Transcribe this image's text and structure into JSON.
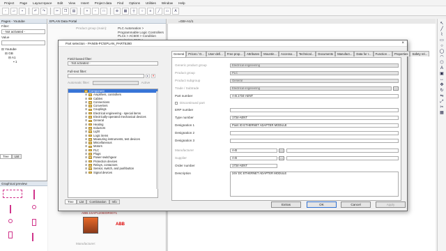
{
  "menu": [
    "Project",
    "Page",
    "Layout space",
    "Edit",
    "View",
    "Insert",
    "Project data",
    "Find",
    "Options",
    "Utilities",
    "Window",
    "Help"
  ],
  "left_pane": {
    "title": "Pages - Youtube",
    "filter_label": "Filter:",
    "filter_value": "- Not activated -",
    "value_label": "Value",
    "tree": [
      "Youtube",
      "GB",
      "A1",
      "1"
    ],
    "tabs": [
      "Tree",
      "List"
    ]
  },
  "graphical_preview": {
    "title": "Graphical preview"
  },
  "portal": {
    "title": "EPLAN Data Portal",
    "product_group_label": "Product group (main):",
    "product_group_value": "PLC Automation > Programmable Logic Controllers PLCs > AC500 > Condition Monitoring CMS >",
    "product_code": "ABB.1SAP120600R0071",
    "manufacturer_label": "Manufacturer:",
    "manufacturer_logo": "ABB"
  },
  "canvas_tab": "=GB+A1/1",
  "dialog": {
    "title": "Part selection - PAN05-PC\\EPLAN_PART5280",
    "field_filter_label": "Field-based filter:",
    "field_filter_value": "- Not activated -",
    "fulltext_label": "Full-text filter:",
    "auto_filter_label": "Automatic filter:",
    "active_label": "Active",
    "tree": [
      {
        "label": "Component",
        "sel": true
      },
      {
        "label": "Amplifiers, controllers"
      },
      {
        "label": "Cables"
      },
      {
        "label": "Connections"
      },
      {
        "label": "Converters"
      },
      {
        "label": "Couplings"
      },
      {
        "label": "Electrical engineering - special items"
      },
      {
        "label": "Electrically-operated mechanical devices"
      },
      {
        "label": "General"
      },
      {
        "label": "Heating"
      },
      {
        "label": "Inductors"
      },
      {
        "label": "Light"
      },
      {
        "label": "Logic items"
      },
      {
        "label": "Measuring instruments, test devices"
      },
      {
        "label": "Miscellaneous"
      },
      {
        "label": "Motors"
      },
      {
        "label": "PLC"
      },
      {
        "label": "Plugs"
      },
      {
        "label": "Power switchgear"
      },
      {
        "label": "Protection devices"
      },
      {
        "label": "Relays, contactors"
      },
      {
        "label": "Sensor, switch, and pushbutton"
      },
      {
        "label": "Signal devices"
      }
    ],
    "bottom_tabs": [
      "Tree",
      "List",
      "Combination",
      "Info"
    ],
    "prop_tabs": [
      "General",
      "Prices / O...",
      "User-defi...",
      "Free prop...",
      "Attributes",
      "Mountin...",
      "Accesso...",
      "Technical...",
      "Documents",
      "Manufact...",
      "Data for r...",
      "Function ...",
      "Properties",
      "Safety rel..."
    ],
    "fields": {
      "generic_product_group": {
        "label": "Generic product group",
        "value": "Electrical engineering"
      },
      "product_group": {
        "label": "Product group",
        "value": "PLC"
      },
      "product_subgroup": {
        "label": "Product subgroup",
        "value": "General"
      },
      "trade": {
        "label": "Trade / Subtrade",
        "value": "Electrical engineering"
      },
      "part_number": {
        "label": "Part number",
        "value": "A-B.1734-AENT"
      },
      "discontinued": {
        "label": "Discontinued part"
      },
      "erp_number": {
        "label": "ERP number",
        "value": ""
      },
      "type_number": {
        "label": "Type number",
        "value": "1734-AENT"
      },
      "designation1": {
        "label": "Designation 1",
        "value": "Point IO ETHERNET ADAPTER MODULE"
      },
      "designation2": {
        "label": "Designation 2",
        "value": ""
      },
      "designation3": {
        "label": "Designation 3",
        "value": ""
      },
      "manufacturer": {
        "label": "Manufacturer",
        "value": "A-B"
      },
      "supplier": {
        "label": "Supplier",
        "value": "A-B"
      },
      "order_number": {
        "label": "Order number",
        "value": "1734-AENT"
      },
      "description": {
        "label": "Description",
        "value": "24V DC ETHERNET ADAPTER MODULE"
      }
    },
    "buttons": {
      "extras": "Extras",
      "ok": "OK",
      "cancel": "Cancel",
      "apply": "Apply"
    }
  }
}
